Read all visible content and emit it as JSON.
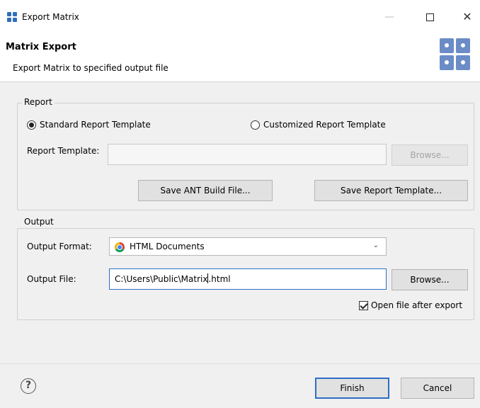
{
  "window": {
    "title": "Export Matrix",
    "app_icon": "grid-icon",
    "minimize_glyph": "—",
    "close_glyph": "✕"
  },
  "header": {
    "title": "Matrix Export",
    "description": "Export Matrix to specified output file",
    "banner_icon": "matrix-icon"
  },
  "report": {
    "legend": "Report",
    "standard_label": "Standard Report Template",
    "customized_label": "Customized Report Template",
    "selected": "standard",
    "template_label": "Report Template:",
    "template_value": "",
    "browse_label": "Browse...",
    "save_ant_label": "Save ANT Build File...",
    "save_template_label": "Save Report Template..."
  },
  "output": {
    "legend": "Output",
    "format_label": "Output Format:",
    "format_value": "HTML Documents",
    "format_icon": "chrome-icon",
    "file_label": "Output File:",
    "file_value_before_caret": "C:\\Users\\Public\\Matrix",
    "file_value_after_caret": ".html",
    "browse_label": "Browse...",
    "open_after_label": "Open file after export",
    "open_after_checked": true
  },
  "footer": {
    "help_glyph": "?",
    "finish_label": "Finish",
    "cancel_label": "Cancel"
  },
  "colors": {
    "accent": "#2d6fc6",
    "icon_blue": "#6b8cc6"
  }
}
